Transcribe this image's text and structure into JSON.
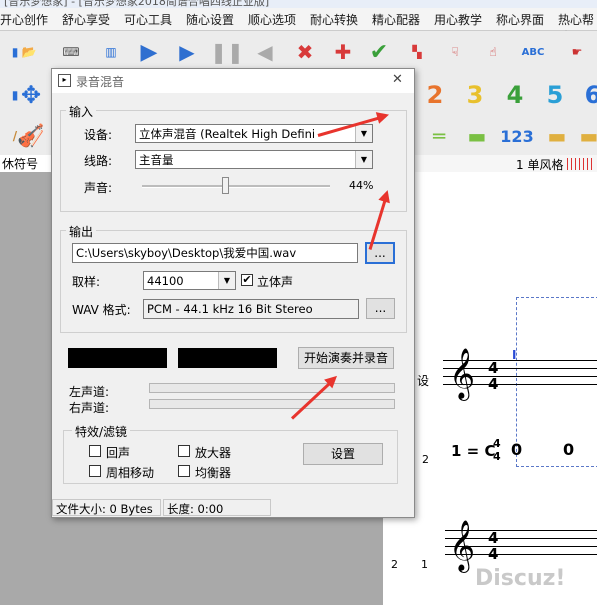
{
  "app": {
    "title_strip": "[音乐梦想家] - [音乐梦想家2018简谱合唱四线正业版]"
  },
  "menu": [
    "开心创作",
    "舒心享受",
    "可心工具",
    "随心设置",
    "顺心选项",
    "耐心转换",
    "精心配器",
    "用心教学",
    "称心界面",
    "热心帮助"
  ],
  "toolbar2_digits": [
    "2",
    "3",
    "4",
    "5",
    "6"
  ],
  "toolbar3_text": "123",
  "left_panel": {
    "label": "休符号"
  },
  "score": {
    "head_label": "1 单风格",
    "clef_symbol": "𝄞",
    "time_sig_top": "4",
    "time_sig_bottom": "4",
    "key_sig": "1 = C",
    "key_time_top": "4",
    "key_time_bottom": "4",
    "note1": "0",
    "note2": "0",
    "row_num_a": "2",
    "row_num_b": "2",
    "row_num_c": "1",
    "side_label": "设",
    "cursor": "I",
    "watermark": "Discuz!"
  },
  "dialog": {
    "title": "录音混音",
    "input_group": "输入",
    "device_label": "设备:",
    "device_value": "立体声混音 (Realtek High Defini",
    "line_label": "线路:",
    "line_value": "主音量",
    "volume_label": "声音:",
    "volume_percent": "44%",
    "volume_fraction": 0.44,
    "output_group": "输出",
    "path_value": "C:\\Users\\skyboy\\Desktop\\我爱中国.wav",
    "browse_label": "...",
    "sample_label": "取样:",
    "sample_value": "44100",
    "stereo_label": "立体声",
    "wav_label": "WAV 格式:",
    "wav_value": "PCM - 44.1 kHz 16 Bit Stereo",
    "wav_btn_label": "...",
    "record_btn": "开始演奏并录音",
    "left_channel": "左声道:",
    "right_channel": "右声道:",
    "effects_group": "特效/滤镜",
    "echo": "回声",
    "amplifier": "放大器",
    "phase": "周相移动",
    "equalizer": "均衡器",
    "settings_btn": "设置",
    "file_size": "文件大小: 0 Bytes",
    "length": "长度: 0:00",
    "close_icon": "✕"
  }
}
